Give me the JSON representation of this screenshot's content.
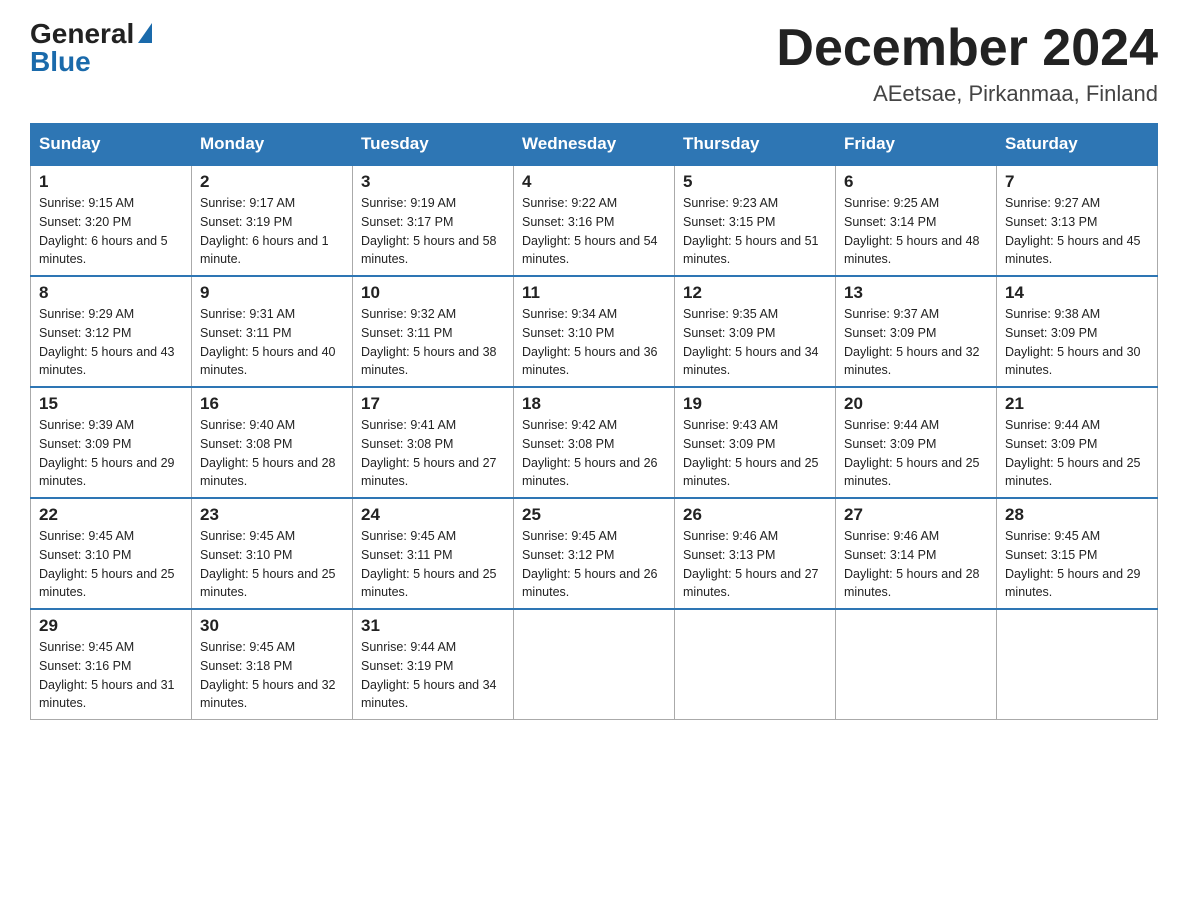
{
  "header": {
    "logo_general": "General",
    "logo_blue": "Blue",
    "month_title": "December 2024",
    "location": "AEetsae, Pirkanmaa, Finland"
  },
  "days_of_week": [
    "Sunday",
    "Monday",
    "Tuesday",
    "Wednesday",
    "Thursday",
    "Friday",
    "Saturday"
  ],
  "weeks": [
    [
      {
        "day": "1",
        "sunrise": "9:15 AM",
        "sunset": "3:20 PM",
        "daylight": "6 hours and 5 minutes."
      },
      {
        "day": "2",
        "sunrise": "9:17 AM",
        "sunset": "3:19 PM",
        "daylight": "6 hours and 1 minute."
      },
      {
        "day": "3",
        "sunrise": "9:19 AM",
        "sunset": "3:17 PM",
        "daylight": "5 hours and 58 minutes."
      },
      {
        "day": "4",
        "sunrise": "9:22 AM",
        "sunset": "3:16 PM",
        "daylight": "5 hours and 54 minutes."
      },
      {
        "day": "5",
        "sunrise": "9:23 AM",
        "sunset": "3:15 PM",
        "daylight": "5 hours and 51 minutes."
      },
      {
        "day": "6",
        "sunrise": "9:25 AM",
        "sunset": "3:14 PM",
        "daylight": "5 hours and 48 minutes."
      },
      {
        "day": "7",
        "sunrise": "9:27 AM",
        "sunset": "3:13 PM",
        "daylight": "5 hours and 45 minutes."
      }
    ],
    [
      {
        "day": "8",
        "sunrise": "9:29 AM",
        "sunset": "3:12 PM",
        "daylight": "5 hours and 43 minutes."
      },
      {
        "day": "9",
        "sunrise": "9:31 AM",
        "sunset": "3:11 PM",
        "daylight": "5 hours and 40 minutes."
      },
      {
        "day": "10",
        "sunrise": "9:32 AM",
        "sunset": "3:11 PM",
        "daylight": "5 hours and 38 minutes."
      },
      {
        "day": "11",
        "sunrise": "9:34 AM",
        "sunset": "3:10 PM",
        "daylight": "5 hours and 36 minutes."
      },
      {
        "day": "12",
        "sunrise": "9:35 AM",
        "sunset": "3:09 PM",
        "daylight": "5 hours and 34 minutes."
      },
      {
        "day": "13",
        "sunrise": "9:37 AM",
        "sunset": "3:09 PM",
        "daylight": "5 hours and 32 minutes."
      },
      {
        "day": "14",
        "sunrise": "9:38 AM",
        "sunset": "3:09 PM",
        "daylight": "5 hours and 30 minutes."
      }
    ],
    [
      {
        "day": "15",
        "sunrise": "9:39 AM",
        "sunset": "3:09 PM",
        "daylight": "5 hours and 29 minutes."
      },
      {
        "day": "16",
        "sunrise": "9:40 AM",
        "sunset": "3:08 PM",
        "daylight": "5 hours and 28 minutes."
      },
      {
        "day": "17",
        "sunrise": "9:41 AM",
        "sunset": "3:08 PM",
        "daylight": "5 hours and 27 minutes."
      },
      {
        "day": "18",
        "sunrise": "9:42 AM",
        "sunset": "3:08 PM",
        "daylight": "5 hours and 26 minutes."
      },
      {
        "day": "19",
        "sunrise": "9:43 AM",
        "sunset": "3:09 PM",
        "daylight": "5 hours and 25 minutes."
      },
      {
        "day": "20",
        "sunrise": "9:44 AM",
        "sunset": "3:09 PM",
        "daylight": "5 hours and 25 minutes."
      },
      {
        "day": "21",
        "sunrise": "9:44 AM",
        "sunset": "3:09 PM",
        "daylight": "5 hours and 25 minutes."
      }
    ],
    [
      {
        "day": "22",
        "sunrise": "9:45 AM",
        "sunset": "3:10 PM",
        "daylight": "5 hours and 25 minutes."
      },
      {
        "day": "23",
        "sunrise": "9:45 AM",
        "sunset": "3:10 PM",
        "daylight": "5 hours and 25 minutes."
      },
      {
        "day": "24",
        "sunrise": "9:45 AM",
        "sunset": "3:11 PM",
        "daylight": "5 hours and 25 minutes."
      },
      {
        "day": "25",
        "sunrise": "9:45 AM",
        "sunset": "3:12 PM",
        "daylight": "5 hours and 26 minutes."
      },
      {
        "day": "26",
        "sunrise": "9:46 AM",
        "sunset": "3:13 PM",
        "daylight": "5 hours and 27 minutes."
      },
      {
        "day": "27",
        "sunrise": "9:46 AM",
        "sunset": "3:14 PM",
        "daylight": "5 hours and 28 minutes."
      },
      {
        "day": "28",
        "sunrise": "9:45 AM",
        "sunset": "3:15 PM",
        "daylight": "5 hours and 29 minutes."
      }
    ],
    [
      {
        "day": "29",
        "sunrise": "9:45 AM",
        "sunset": "3:16 PM",
        "daylight": "5 hours and 31 minutes."
      },
      {
        "day": "30",
        "sunrise": "9:45 AM",
        "sunset": "3:18 PM",
        "daylight": "5 hours and 32 minutes."
      },
      {
        "day": "31",
        "sunrise": "9:44 AM",
        "sunset": "3:19 PM",
        "daylight": "5 hours and 34 minutes."
      },
      null,
      null,
      null,
      null
    ]
  ]
}
